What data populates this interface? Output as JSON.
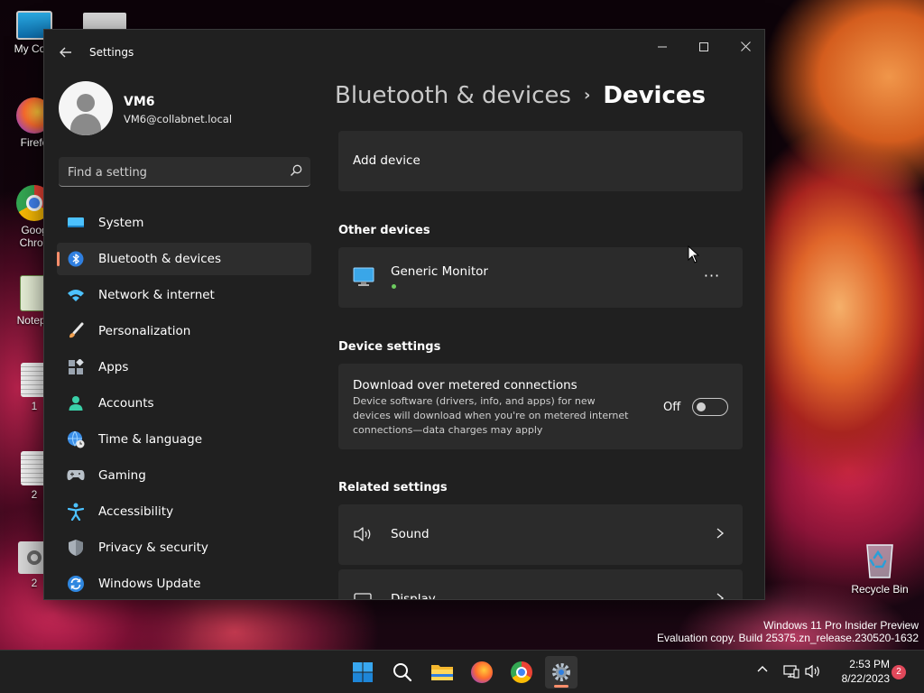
{
  "desktop": {
    "icons": [
      {
        "label": "My Com",
        "icon": "monitor-icon"
      },
      {
        "label": "Firefo",
        "icon": "firefox-icon"
      },
      {
        "label": "Goog",
        "label2": "Chron",
        "icon": "chrome-icon"
      },
      {
        "label": "Notepa",
        "icon": "notepad-icon"
      },
      {
        "label": "1",
        "icon": "document-icon"
      },
      {
        "label": "2",
        "icon": "document-icon"
      },
      {
        "label": "2",
        "icon": "settings-shortcut-icon"
      }
    ],
    "recycle_bin": "Recycle Bin",
    "watermark": {
      "line1": "Windows 11 Pro Insider Preview",
      "line2": "Evaluation copy. Build 25375.zn_release.230520-1632"
    }
  },
  "window": {
    "title": "Settings",
    "controls": {
      "minimize": "—",
      "maximize": "☐",
      "close": "✕"
    }
  },
  "profile": {
    "name": "VM6",
    "email": "VM6@collabnet.local"
  },
  "search": {
    "placeholder": "Find a setting"
  },
  "nav": {
    "items": [
      {
        "label": "System",
        "icon": "system-icon"
      },
      {
        "label": "Bluetooth & devices",
        "icon": "bluetooth-icon",
        "active": true
      },
      {
        "label": "Network & internet",
        "icon": "wifi-icon"
      },
      {
        "label": "Personalization",
        "icon": "brush-icon"
      },
      {
        "label": "Apps",
        "icon": "apps-icon"
      },
      {
        "label": "Accounts",
        "icon": "accounts-icon"
      },
      {
        "label": "Time & language",
        "icon": "globe-clock-icon"
      },
      {
        "label": "Gaming",
        "icon": "gamepad-icon"
      },
      {
        "label": "Accessibility",
        "icon": "accessibility-icon"
      },
      {
        "label": "Privacy & security",
        "icon": "shield-icon"
      },
      {
        "label": "Windows Update",
        "icon": "update-icon"
      }
    ]
  },
  "breadcrumb": {
    "parent": "Bluetooth & devices",
    "separator": "›",
    "current": "Devices"
  },
  "content": {
    "add_device": "Add device",
    "other_devices": {
      "title": "Other devices",
      "devices": [
        {
          "name": "Generic Monitor",
          "more": "···"
        }
      ]
    },
    "device_settings": {
      "title": "Device settings",
      "metered": {
        "title": "Download over metered connections",
        "description": "Device software (drivers, info, and apps) for new devices will download when you're on metered internet connections—data charges may apply",
        "state_label": "Off"
      }
    },
    "related": {
      "title": "Related settings",
      "items": [
        {
          "label": "Sound"
        },
        {
          "label": "Display"
        }
      ]
    }
  },
  "taskbar": {
    "apps": [
      "start-icon",
      "search-icon",
      "file-explorer-icon",
      "firefox-icon",
      "chrome-icon",
      "settings-icon"
    ],
    "time": "2:53 PM",
    "date": "8/22/2023",
    "notifications": "2",
    "tray_chevron": "^"
  },
  "colors": {
    "accent": "#ff8e6b",
    "window_bg": "#202020",
    "card_bg": "#2b2b2b"
  }
}
